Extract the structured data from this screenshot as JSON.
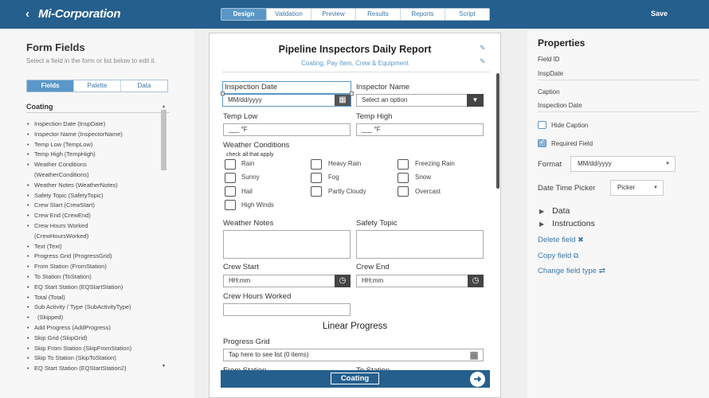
{
  "header": {
    "back_icon": "‹",
    "brand": "Mi-Corporation",
    "tabs": [
      "Design",
      "Validation",
      "Preview",
      "Results",
      "Reports",
      "Script"
    ],
    "active_tab": "Design",
    "save_label": "Save"
  },
  "left_panel": {
    "title": "Form Fields",
    "help": "Select a field in the form or list below to edit it.",
    "tabs": [
      "Fields",
      "Palette",
      "Data"
    ],
    "category": "Coating",
    "items": [
      "Inspection Date (InspDate)",
      "Inspector Name (InspectorName)",
      "Temp Low (TempLow)",
      "Temp High (TempHigh)",
      "Weather Conditions",
      "(WeatherConditions)",
      "Weather Notes (WeatherNotes)",
      "Safety Topic (SafetyTopic)",
      "Crew Start (CrewStart)",
      "Crew End (CrewEnd)",
      "Crew Hours Worked",
      "(CrewHoursWorked)",
      "Text (Text)",
      "Progress Grid (ProgressGrid)",
      "From Station (FromStation)",
      "To Station (ToStation)",
      "EQ Start Station (EQStartStation)",
      "Total (Total)",
      "Sub Activity / Type (SubActivityType)",
      "(Skipped)",
      "Add Progress (AddProgress)",
      "Skip Grid (SkipGrid)",
      "Skip From Station (SkipFromStation)",
      "Skip To Station (SkipToStation)",
      "EQ Start Station (EQStartStation2)"
    ],
    "continuation_rows": [
      5,
      11
    ]
  },
  "form": {
    "title": "Pipeline Inspectors Daily Report",
    "subtitle": "Coating, Pay Item, Crew & Equipment",
    "inspection_date_label": "Inspection Date",
    "inspection_date_placeholder": "MM/dd/yyyy",
    "inspector_name_label": "Inspector Name",
    "inspector_name_value": "Select an option",
    "temp_low_label": "Temp Low",
    "temp_low_value": "___ °F",
    "temp_high_label": "Temp High",
    "temp_high_value": "___ °F",
    "weather_label": "Weather Conditions",
    "weather_hint": "check all that apply",
    "weather_options": [
      "Rain",
      "Heavy Rain",
      "Freezing Rain",
      "Sunny",
      "Fog",
      "Snow",
      "Hail",
      "Partly Cloudy",
      "Overcast",
      "High Winds"
    ],
    "weather_notes_label": "Weather Notes",
    "safety_topic_label": "Safety Topic",
    "crew_start_label": "Crew Start",
    "crew_start_placeholder": "HH:mm",
    "crew_end_label": "Crew End",
    "crew_end_placeholder": "HH:mm",
    "crew_hours_label": "Crew Hours Worked",
    "linear_progress": "Linear Progress",
    "progress_grid_label": "Progress Grid",
    "progress_grid_value": "Tap here to see list (0 items)",
    "from_station_label": "From Station",
    "to_station_label": "To Station"
  },
  "bottom_bar": {
    "page_label": "Coating",
    "next_icon": "arrow-right-circle-icon"
  },
  "properties": {
    "title": "Properties",
    "field_id_label": "Field ID",
    "field_id_value": "InspDate",
    "caption_label": "Caption",
    "caption_value": "Inspection Date",
    "hide_caption_label": "Hide Caption",
    "hide_caption_checked": false,
    "required_label": "Required Field",
    "required_checked": true,
    "format_label": "Format",
    "format_value": "MM/dd/yyyy",
    "picker_label": "Date Time Picker",
    "picker_value": "Picker",
    "data_label": "Data",
    "instructions_label": "Instructions",
    "delete_label": "Delete field",
    "copy_label": "Copy field",
    "change_type_label": "Change field type"
  },
  "colors": {
    "header": "#255f8d",
    "accent": "#5a97c8",
    "link": "#3c77a7"
  }
}
